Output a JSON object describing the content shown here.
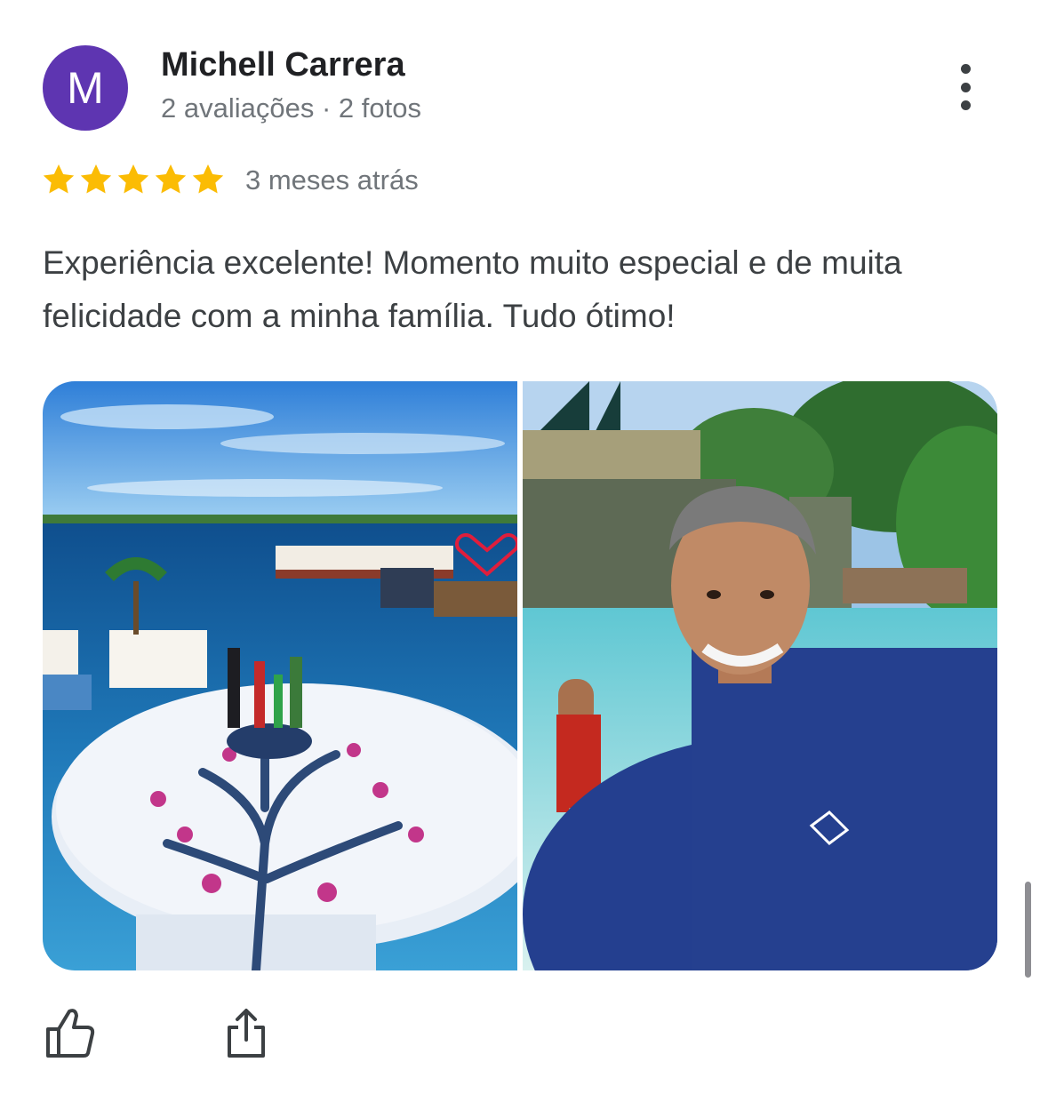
{
  "review": {
    "author": {
      "initial": "M",
      "name": "Michell Carrera",
      "meta": "2 avaliações · 2 fotos",
      "avatar_color": "#5e35b1"
    },
    "rating": 5,
    "rating_max": 5,
    "time_ago": "3 meses atrás",
    "text": "Experiência excelente! Momento muito especial e de muita felicidade com a minha família. Tudo ótimo!",
    "photos": [
      {
        "subject": "heart-shaped-tree-platform-beach-photo"
      },
      {
        "subject": "water-park-selfie-photo"
      }
    ],
    "actions": [
      {
        "icon": "thumbs-up-icon"
      },
      {
        "icon": "share-icon"
      }
    ],
    "colors": {
      "star": "#fbbc04",
      "text": "#3c4043",
      "muted": "#70757a"
    }
  }
}
